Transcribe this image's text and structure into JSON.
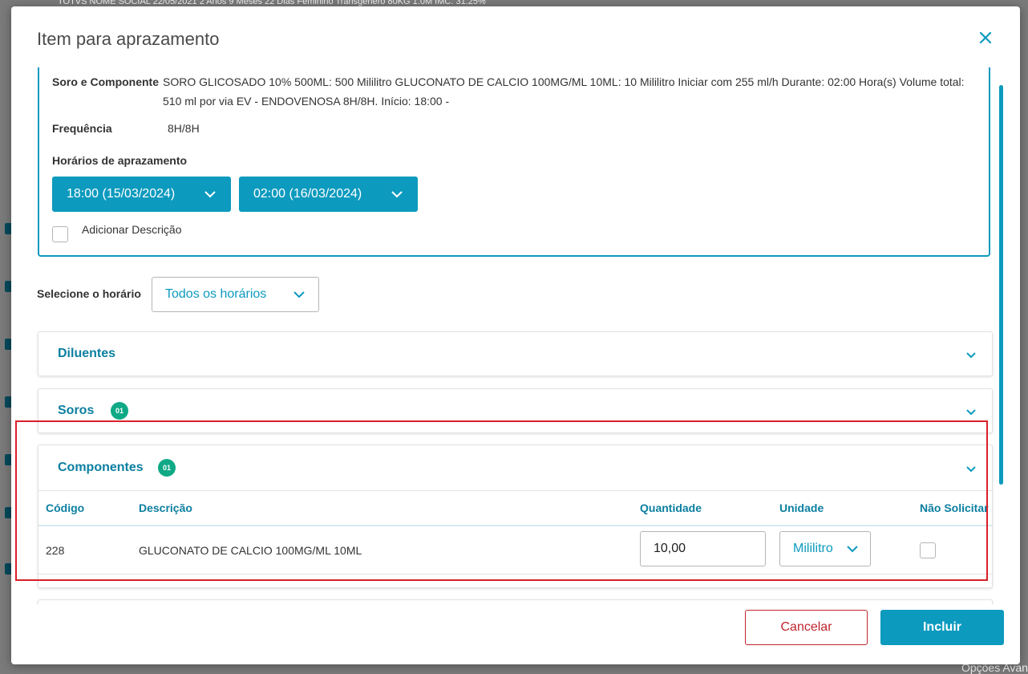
{
  "background": {
    "header_text": "TOTVS NOME SOCIAL   22/05/2021   2 Anos 9 Meses 22 Dias   Feminino   Transgênero   80KG   1.0M   IMC: 31.25%",
    "bottom_text": "Opções Avan"
  },
  "modal": {
    "title": "Item para aprazamento",
    "close_icon": "close-icon"
  },
  "info": {
    "soro_label": "Soro e Componente",
    "soro_value": "SORO GLICOSADO 10% 500ML: 500 Mililitro GLUCONATO DE CALCIO 100MG/ML 10ML: 10 Mililitro Iniciar com 255 ml/h Durante: 02:00 Hora(s) Volume total: 510 ml por via EV - ENDOVENOSA 8H/8H. Início: 18:00 -",
    "freq_label": "Frequência",
    "freq_value": "8H/8H",
    "horarios_label": "Horários de aprazamento",
    "time1": "18:00 (15/03/2024)",
    "time2": "02:00 (16/03/2024)",
    "add_desc_label": "Adicionar Descrição"
  },
  "filter": {
    "label": "Selecione o horário",
    "value": "Todos os horários"
  },
  "sections": {
    "diluentes": "Diluentes",
    "soros": "Soros",
    "soros_badge": "01",
    "componentes": "Componentes",
    "componentes_badge": "01"
  },
  "table": {
    "headers": [
      "Código",
      "Descrição",
      "Quantidade",
      "Unidade",
      "Não Solicitar"
    ],
    "rows": [
      {
        "codigo": "228",
        "descricao": "GLUCONATO DE CALCIO 100MG/ML 10ML",
        "quantidade": "10,00",
        "unidade": "Mililitro"
      }
    ]
  },
  "footer": {
    "cancel": "Cancelar",
    "include": "Incluir"
  },
  "colors": {
    "primary": "#0c9abe",
    "badge": "#0fa986",
    "danger": "#c0262d",
    "highlight": "#d9202b"
  }
}
